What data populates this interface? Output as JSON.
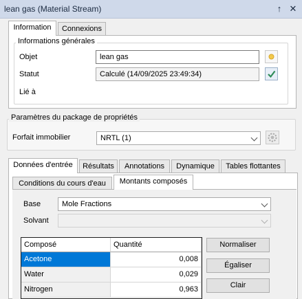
{
  "window": {
    "title": "lean gas (Material Stream)",
    "pin_glyph": "↑",
    "close_glyph": "✕"
  },
  "top_tabs": [
    {
      "label": "Information",
      "active": true
    },
    {
      "label": "Connexions",
      "active": false
    }
  ],
  "general_info": {
    "legend": "Informations générales",
    "object_label": "Objet",
    "object_value": "lean gas",
    "status_label": "Statut",
    "status_value": "Calculé (14/09/2025 23:49:34)",
    "linked_label": "Lié à"
  },
  "property_package": {
    "legend": "Paramètres du package de propriétés",
    "label": "Forfait immobilier",
    "selected": "NRTL (1)"
  },
  "data_tabs": [
    {
      "label": "Données d'entrée",
      "active": true
    },
    {
      "label": "Résultats",
      "active": false
    },
    {
      "label": "Annotations",
      "active": false
    },
    {
      "label": "Dynamique",
      "active": false
    },
    {
      "label": "Tables flottantes",
      "active": false
    }
  ],
  "input_subtabs": [
    {
      "label": "Conditions du cours d'eau",
      "active": false
    },
    {
      "label": "Montants composés",
      "active": true
    }
  ],
  "composition": {
    "base_label": "Base",
    "base_selected": "Mole Fractions",
    "solvent_label": "Solvant",
    "solvent_selected": "",
    "columns": [
      "Composé",
      "Quantité"
    ],
    "rows": [
      {
        "compound": "Acetone",
        "quantity": "0,008",
        "selected": true
      },
      {
        "compound": "Water",
        "quantity": "0,029",
        "selected": false
      },
      {
        "compound": "Nitrogen",
        "quantity": "0,963",
        "selected": false
      }
    ],
    "buttons": {
      "normalize": "Normaliser",
      "equalize": "Égaliser",
      "clear": "Clair"
    }
  },
  "colors": {
    "title_bar": "#cfd9ea",
    "selection": "#0078d7",
    "status_ok": "#2e8b57"
  },
  "icons": {
    "object_edit": "pencil-icon",
    "status_ok": "checkmark-icon",
    "package_settings": "gear-icon"
  }
}
